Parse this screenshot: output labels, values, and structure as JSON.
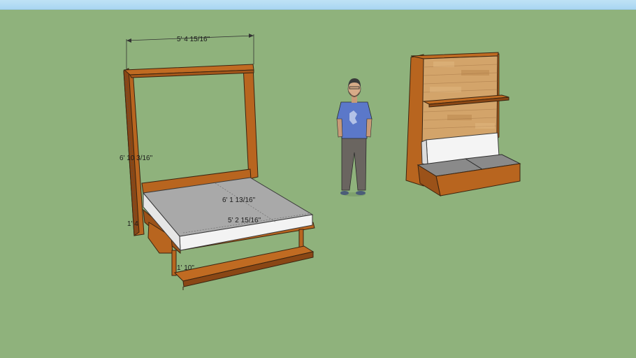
{
  "viewport": {
    "background": "#8fb27c",
    "sky_color": "#a9d6f2"
  },
  "model": {
    "wall_bed_open": {
      "dimensions": {
        "width_label": "5' 4 15/16\"",
        "height_label": "6' 10 3/16\"",
        "bed_depth_label": "6' 1 13/16\"",
        "bed_width_label": "5' 2 15/16\"",
        "leg_height_label": "1' 4",
        "shelf_label": "1' 10\""
      },
      "colors": {
        "wood": "#b8651f",
        "mattress_top": "#a7a7a7",
        "mattress_side": "#f2f2f2"
      }
    },
    "person": {
      "icon": "scale-figure-person",
      "shirt_color": "#5b78c9",
      "pants_color": "#6a6560"
    },
    "wall_bed_closed": {
      "panel_color": "#d3a46a",
      "cushion_back": "#f4f4f4",
      "cushion_seat": "#8a8a8a"
    }
  }
}
